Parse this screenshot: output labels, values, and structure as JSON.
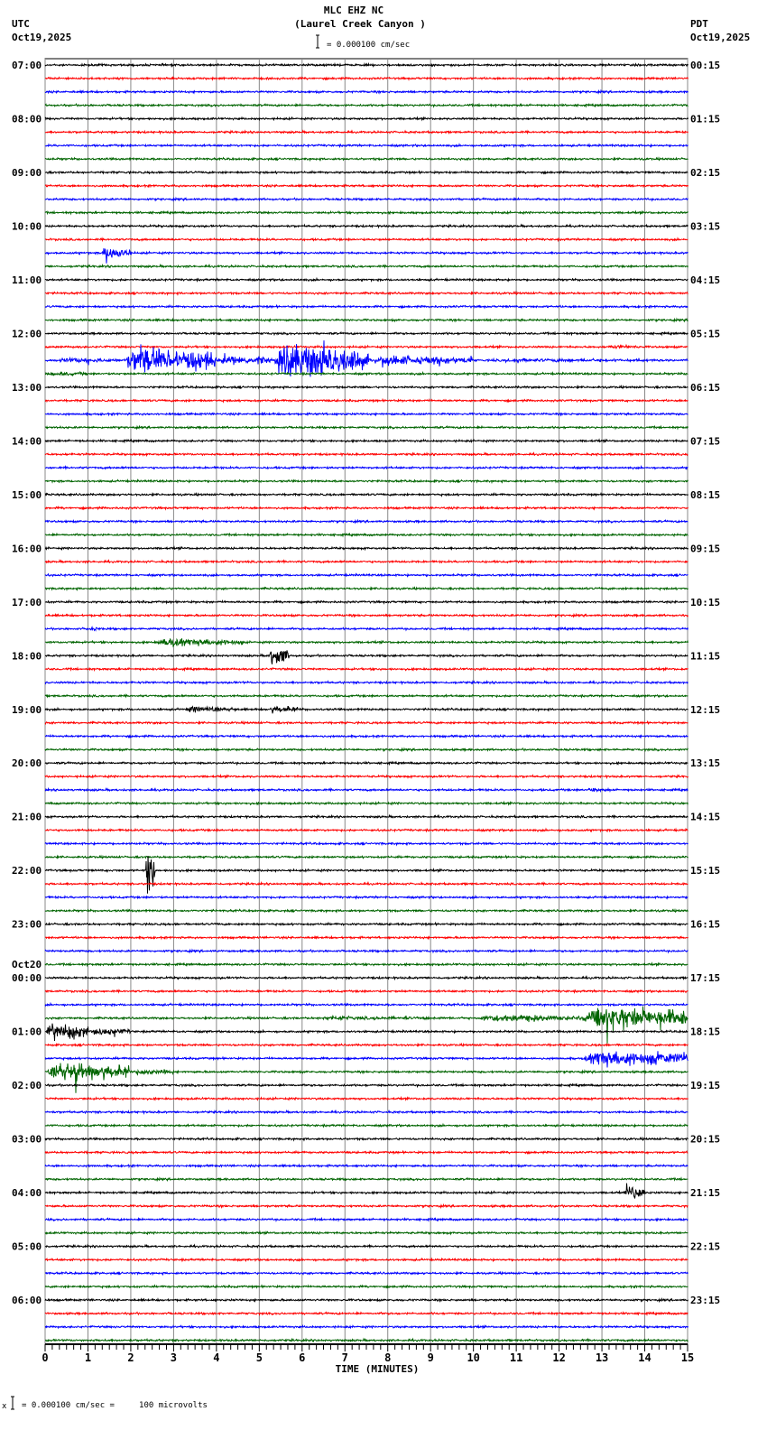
{
  "header": {
    "station": "MLC EHZ NC",
    "location": "(Laurel Creek Canyon )",
    "left_tz": "UTC",
    "left_date": "Oct19,2025",
    "right_tz": "PDT",
    "right_date": "Oct19,2025",
    "scale_text": "= 0.000100 cm/sec"
  },
  "footer": {
    "prefix": "x",
    "scale_text": "= 0.000100 cm/sec =     100 microvolts"
  },
  "chart_data": {
    "type": "line",
    "title": "MLC EHZ NC (Laurel Creek Canyon )",
    "xlabel": "TIME (MINUTES)",
    "xlim": [
      0,
      15
    ],
    "x_ticks": [
      "0",
      "1",
      "2",
      "3",
      "4",
      "5",
      "6",
      "7",
      "8",
      "9",
      "10",
      "11",
      "12",
      "13",
      "14",
      "15"
    ],
    "traces_per_hour": 4,
    "trace_colors": [
      "#000000",
      "#ff0000",
      "#0000ff",
      "#006400"
    ],
    "grid": true,
    "left_labels": [
      "07:00",
      "08:00",
      "09:00",
      "10:00",
      "11:00",
      "12:00",
      "13:00",
      "14:00",
      "15:00",
      "16:00",
      "17:00",
      "18:00",
      "19:00",
      "20:00",
      "21:00",
      "22:00",
      "23:00",
      "00:00",
      "01:00",
      "02:00",
      "03:00",
      "04:00",
      "05:00",
      "06:00"
    ],
    "date_change_label": "Oct20",
    "right_labels": [
      "00:15",
      "01:15",
      "02:15",
      "03:15",
      "04:15",
      "05:15",
      "06:15",
      "07:15",
      "08:15",
      "09:15",
      "10:15",
      "11:15",
      "12:15",
      "13:15",
      "14:15",
      "15:15",
      "16:15",
      "17:15",
      "18:15",
      "19:15",
      "20:15",
      "21:15",
      "22:15",
      "23:15"
    ],
    "amplitude_units": "scale bars (0.000100 cm/sec)",
    "noise_level": 0.15,
    "events": [
      {
        "trace": 14,
        "start": 1.3,
        "end": 2.0,
        "amp": 1.1
      },
      {
        "trace": 21,
        "start": 13.1,
        "end": 13.9,
        "amp": 0.35
      },
      {
        "trace": 22,
        "start": 0.2,
        "end": 1.8,
        "amp": 0.4
      },
      {
        "trace": 22,
        "start": 1.8,
        "end": 4.0,
        "amp": 2.2
      },
      {
        "trace": 22,
        "start": 4.0,
        "end": 5.3,
        "amp": 0.8
      },
      {
        "trace": 22,
        "start": 5.3,
        "end": 7.6,
        "amp": 3.0
      },
      {
        "trace": 22,
        "start": 7.6,
        "end": 10.0,
        "amp": 0.8
      },
      {
        "trace": 22,
        "start": 10.0,
        "end": 15.0,
        "amp": 0.3
      },
      {
        "trace": 23,
        "start": 0.0,
        "end": 1.0,
        "amp": 0.4
      },
      {
        "trace": 42,
        "start": 0.9,
        "end": 1.3,
        "amp": 0.4
      },
      {
        "trace": 43,
        "start": 2.5,
        "end": 4.6,
        "amp": 0.7
      },
      {
        "trace": 44,
        "start": 5.2,
        "end": 5.7,
        "amp": 1.6
      },
      {
        "trace": 48,
        "start": 3.2,
        "end": 4.5,
        "amp": 0.5
      },
      {
        "trace": 48,
        "start": 5.2,
        "end": 5.9,
        "amp": 0.6
      },
      {
        "trace": 54,
        "start": 12.6,
        "end": 13.2,
        "amp": 0.35
      },
      {
        "trace": 60,
        "start": 2.35,
        "end": 2.55,
        "amp": 4.5
      },
      {
        "trace": 71,
        "start": 6.0,
        "end": 10.0,
        "amp": 0.3
      },
      {
        "trace": 71,
        "start": 10.0,
        "end": 12.5,
        "amp": 0.6
      },
      {
        "trace": 71,
        "start": 12.5,
        "end": 15.0,
        "amp": 2.2
      },
      {
        "trace": 72,
        "start": 0.0,
        "end": 1.0,
        "amp": 1.5
      },
      {
        "trace": 72,
        "start": 1.0,
        "end": 2.0,
        "amp": 0.6
      },
      {
        "trace": 74,
        "start": 12.5,
        "end": 15.0,
        "amp": 1.4
      },
      {
        "trace": 75,
        "start": 0.0,
        "end": 2.0,
        "amp": 1.6
      },
      {
        "trace": 75,
        "start": 2.0,
        "end": 3.0,
        "amp": 0.5
      },
      {
        "trace": 84,
        "start": 13.5,
        "end": 14.0,
        "amp": 1.6
      }
    ]
  }
}
